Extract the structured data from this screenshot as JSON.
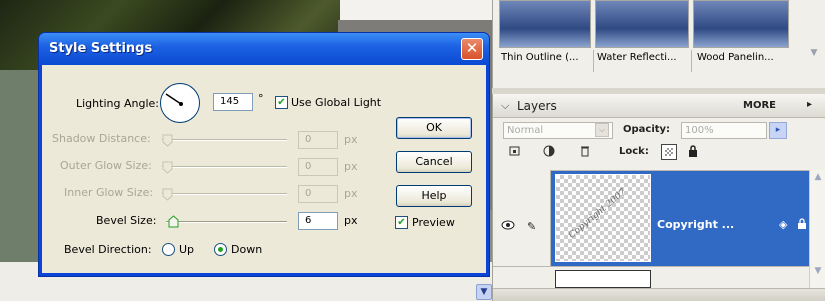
{
  "dialog": {
    "title": "Style Settings",
    "close_glyph": "✕",
    "lighting_angle": {
      "label": "Lighting Angle:",
      "value": "145",
      "unit": "°"
    },
    "use_global_light": {
      "label": "Use Global Light",
      "checked": true
    },
    "shadow_distance": {
      "label": "Shadow Distance:",
      "value": "0",
      "unit": "px",
      "enabled": false
    },
    "outer_glow_size": {
      "label": "Outer Glow Size:",
      "value": "0",
      "unit": "px",
      "enabled": false
    },
    "inner_glow_size": {
      "label": "Inner Glow Size:",
      "value": "0",
      "unit": "px",
      "enabled": false
    },
    "bevel_size": {
      "label": "Bevel Size:",
      "value": "6",
      "unit": "px",
      "enabled": true
    },
    "bevel_direction": {
      "label": "Bevel Direction:",
      "options": [
        "Up",
        "Down"
      ],
      "selected": "Down"
    },
    "buttons": {
      "ok": "OK",
      "cancel": "Cancel",
      "help": "Help"
    },
    "preview": {
      "label": "Preview",
      "checked": true
    }
  },
  "thumbs": {
    "items": [
      "Thin Outline (...",
      "Water Reflecti...",
      "Wood Panelin..."
    ]
  },
  "layers": {
    "title": "Layers",
    "more": "MORE",
    "blend_mode": "Normal",
    "opacity_label": "Opacity:",
    "opacity_value": "100%",
    "lock_label": "Lock:",
    "layer_name": "Copyright ...",
    "thumb_watermark": "Copyright 2007"
  },
  "icons": {
    "checkmark": "✔",
    "chevron_down": "⌵",
    "arrow_right": "▸",
    "eye": "●",
    "brush": "✎",
    "fx": "◈",
    "lock": "▣",
    "scroll_up": "▲",
    "scroll_down": "▼"
  },
  "colors": {
    "title_blue": "#0a45d8",
    "dialog_face": "#ece9d8",
    "selection_blue": "#316ac5"
  }
}
